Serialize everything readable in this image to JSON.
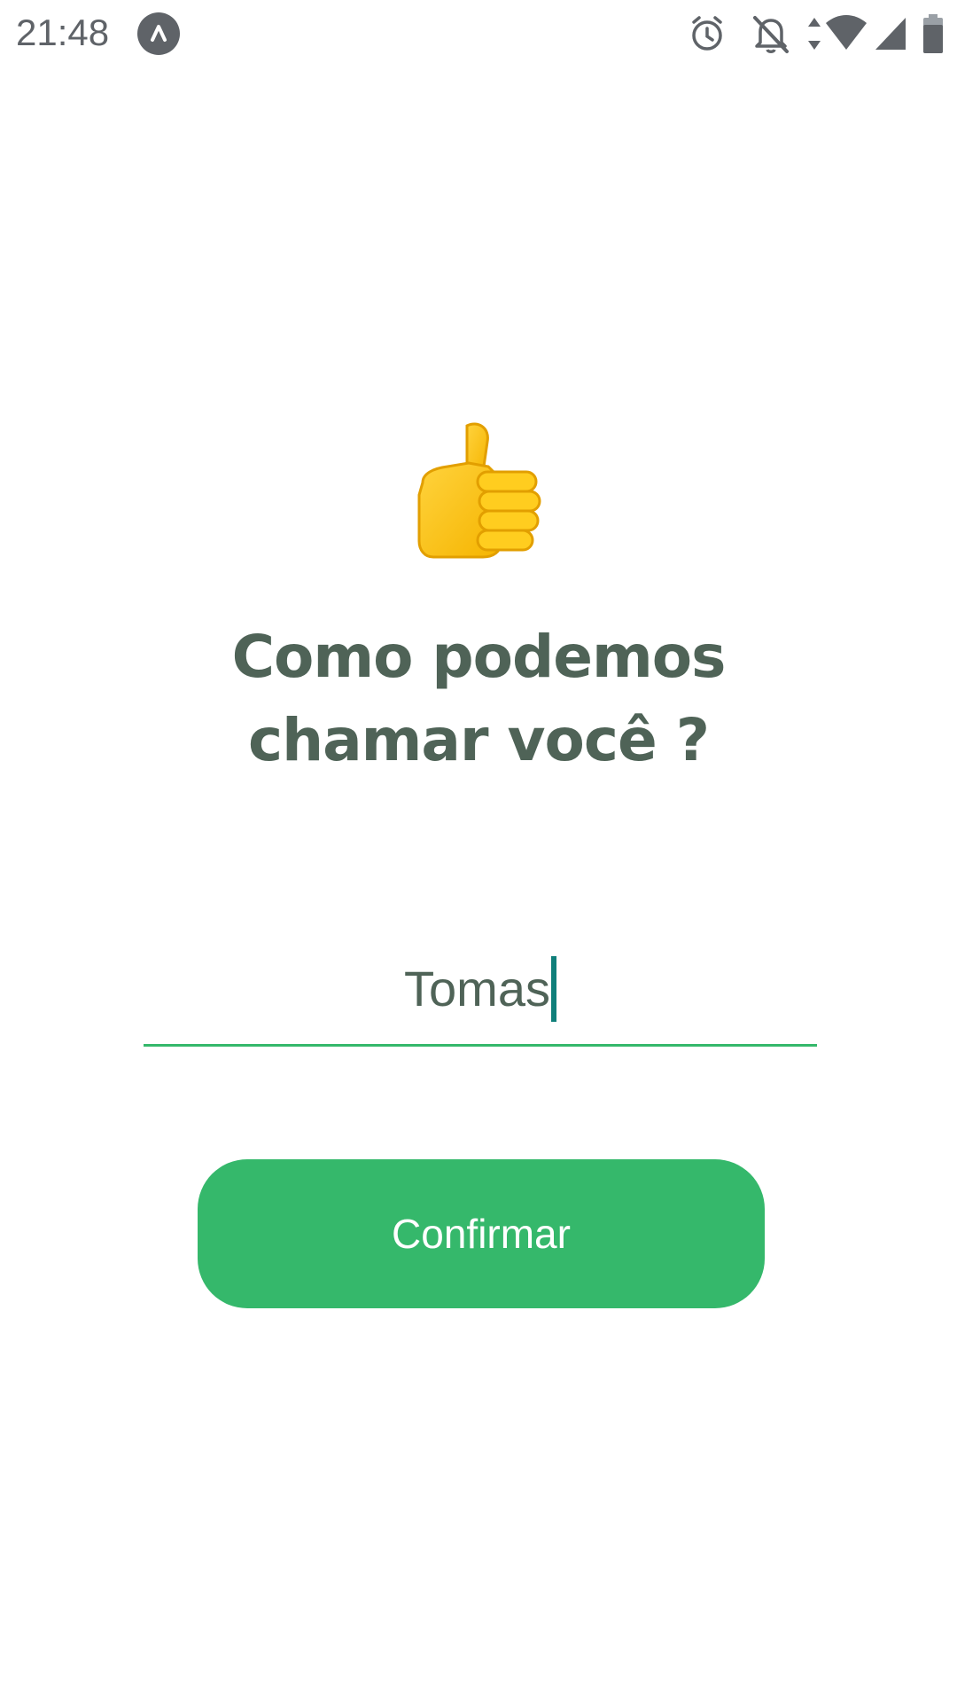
{
  "status_bar": {
    "time": "21:48",
    "app_icon": "react-native-icon",
    "icons": [
      "alarm-icon",
      "notifications-off-icon",
      "data-arrows-icon",
      "wifi-icon",
      "cell-signal-icon",
      "battery-icon"
    ],
    "icon_color": "#5f6368"
  },
  "main": {
    "emoji": "thumbs-up-icon",
    "title": "Como podemos chamar você ?",
    "name_input": {
      "value": "Tomas"
    },
    "confirm_label": "Confirmar"
  },
  "colors": {
    "accent": "#35b86b",
    "heading": "#4f6357",
    "caret": "#0f7f7a",
    "background": "#ffffff"
  }
}
